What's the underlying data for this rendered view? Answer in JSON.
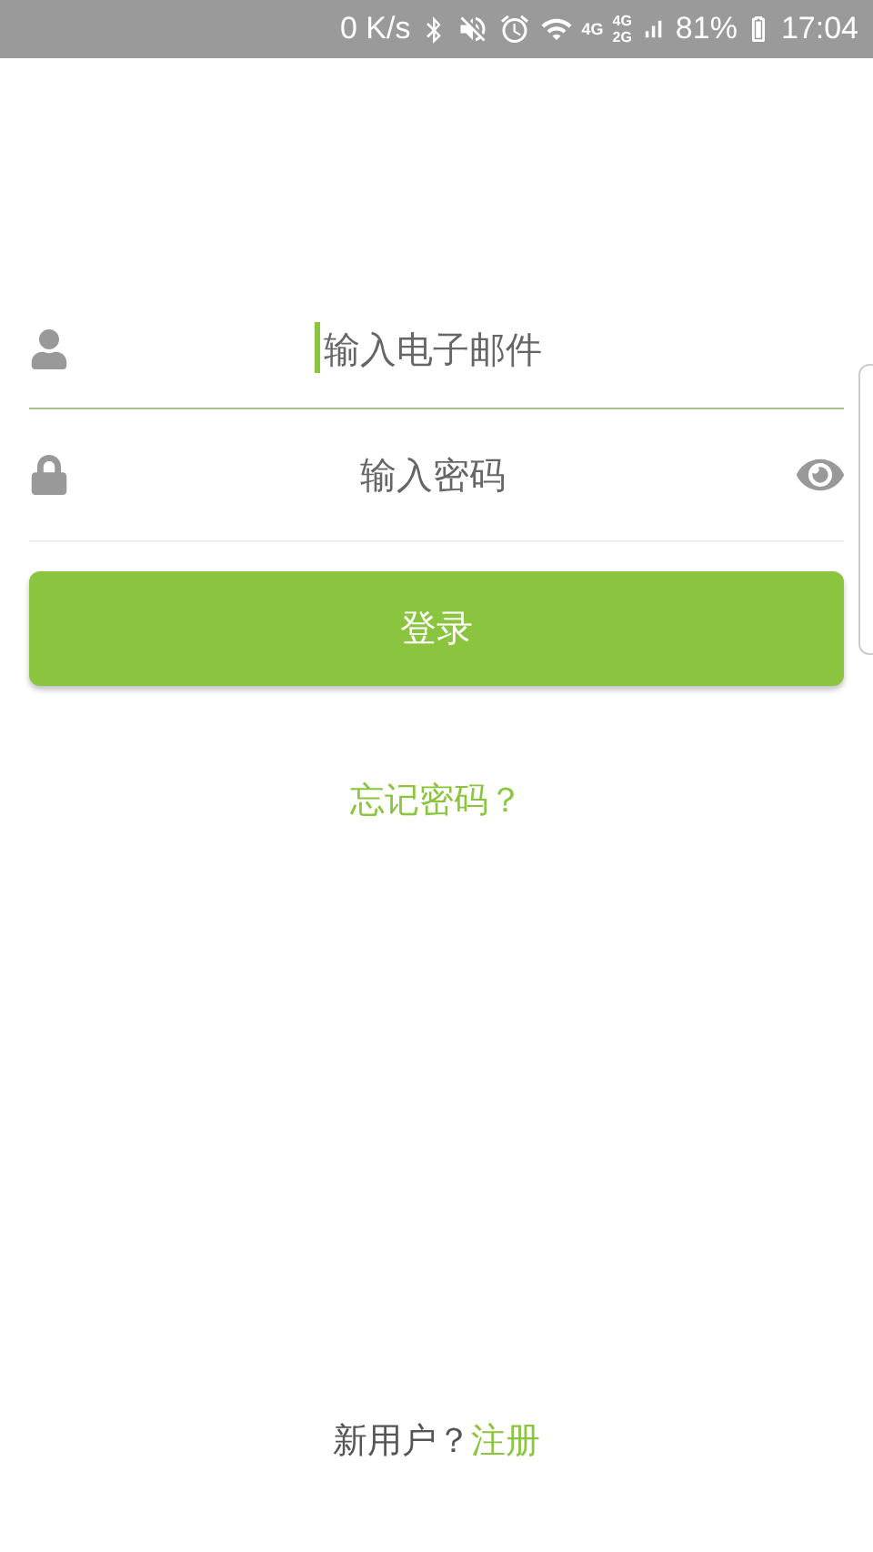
{
  "status_bar": {
    "speed": "0 K/s",
    "network_1": "4G",
    "network_2_top": "4G",
    "network_2_bottom": "2G",
    "battery": "81%",
    "time": "17:04"
  },
  "fields": [
    {
      "kind": "email",
      "placeholder": "输入电子邮件",
      "focused": true
    },
    {
      "kind": "password",
      "placeholder": "输入密码",
      "focused": false
    }
  ],
  "login_button": "登录",
  "forgot_link": "忘记密码？",
  "signup": {
    "prompt": "新用户？",
    "link": "注册"
  }
}
